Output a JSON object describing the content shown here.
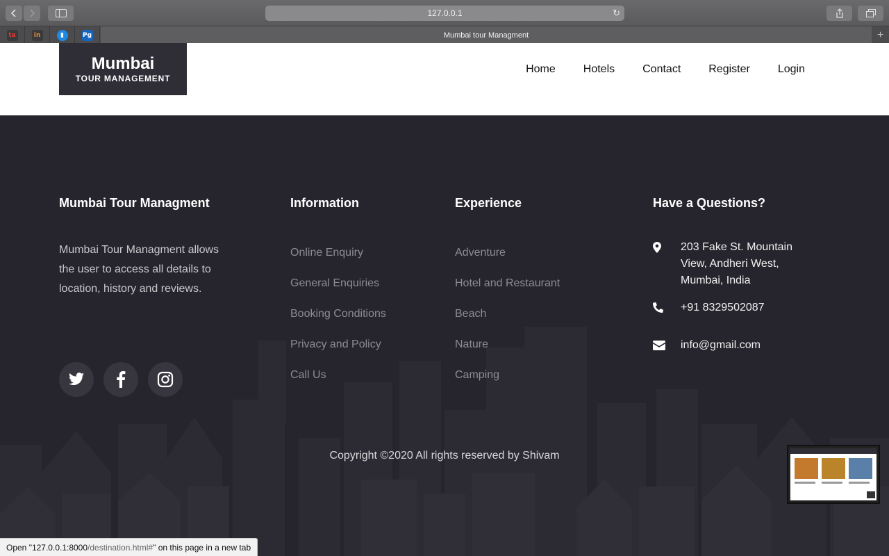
{
  "browser": {
    "url": "127.0.0.1",
    "tab_title": "Mumbai tour Managment",
    "pinned_tabs": [
      {
        "icon": "red-brand-icon",
        "color": "#c0392b",
        "glyph": "ta"
      },
      {
        "icon": "invision-icon",
        "color": "#a0522d",
        "glyph": "in"
      },
      {
        "icon": "book-icon",
        "color": "#1e88e5",
        "glyph": "b"
      },
      {
        "icon": "pg-icon",
        "color": "#1565c0",
        "glyph": "Pg"
      }
    ]
  },
  "header": {
    "logo_main": "Mumbai",
    "logo_sub": "TOUR MANAGEMENT",
    "nav": [
      "Home",
      "Hotels",
      "Contact",
      "Register",
      "Login"
    ]
  },
  "footer": {
    "about_title": "Mumbai Tour Managment",
    "about_text": "Mumbai Tour Managment allows the user to access all details to location, history and reviews.",
    "information_title": "Information",
    "information_links": [
      "Online Enquiry",
      "General Enquiries",
      "Booking Conditions",
      "Privacy and Policy",
      "Call Us"
    ],
    "experience_title": "Experience",
    "experience_links": [
      "Adventure",
      "Hotel and Restaurant",
      "Beach",
      "Nature",
      "Camping"
    ],
    "contact_title": "Have a Questions?",
    "address": "203 Fake St. Mountain View, Andheri West, Mumbai, India",
    "phone": "+91 8329502087",
    "email": "info@gmail.com",
    "social": [
      "twitter-icon",
      "facebook-icon",
      "instagram-icon"
    ],
    "copyright": "Copyright ©2020 All rights reserved by Shivam"
  },
  "status_bar": {
    "prefix": "Open \"",
    "host": "127.0.0.1:8000",
    "path": "/destination.html#",
    "suffix": "\" on this page in a new tab"
  },
  "colors": {
    "footer_bg": "#26252d",
    "logo_bg": "#2f2e37",
    "link_muted": "#8d8c93"
  }
}
